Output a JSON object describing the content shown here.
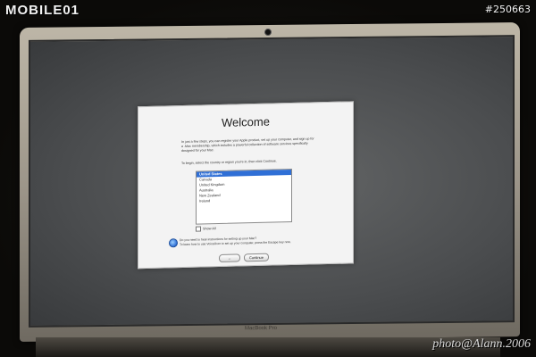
{
  "watermark": {
    "logo_text": "MOBILE01",
    "photo_id": "#250663",
    "credit": "photo@Alann.2006"
  },
  "laptop": {
    "model_label": "MacBook Pro"
  },
  "welcome": {
    "title": "Welcome",
    "intro_text": "In just a few steps, you can register your Apple product, set up your computer, and sign up for a .Mac membership, which includes a powerful collection of software services specifically designed for your Mac.",
    "instruction": "To begin, select the country or region you're in, then click Continue.",
    "countries": [
      "United States",
      "Canada",
      "United Kingdom",
      "Australia",
      "New Zealand",
      "Ireland"
    ],
    "selected_country": "United States",
    "show_all_label": "Show All",
    "show_all_checked": false,
    "voiceover_question": "Do you need to hear instructions for setting up your Mac?",
    "voiceover_hint": "To learn how to use VoiceOver to set up your computer, press the Escape key now.",
    "back_button": "←",
    "continue_button": "Continue"
  },
  "colors": {
    "selection": "#2f6fd6",
    "screen": "#4b4d4f",
    "bezel": "#9d968a"
  }
}
